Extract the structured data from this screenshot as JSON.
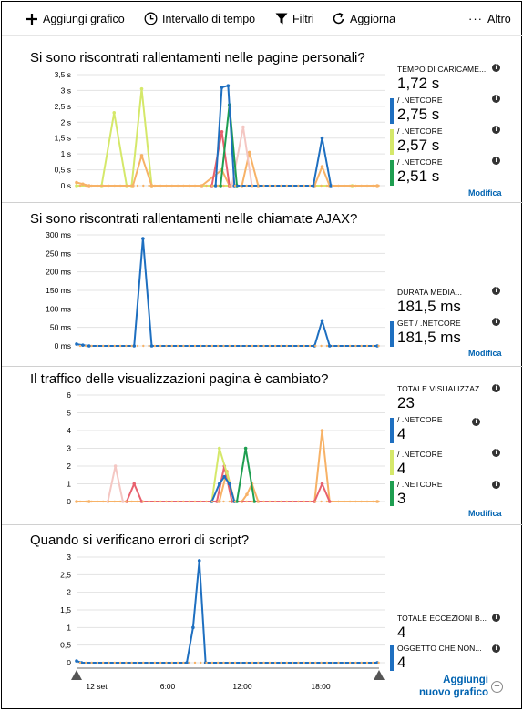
{
  "toolbar": {
    "add_chart": "Aggiungi grafico",
    "time_range": "Intervallo di tempo",
    "filters": "Filtri",
    "refresh": "Aggiorna",
    "more": "Altro"
  },
  "colors": {
    "blue": "#1e6fc0",
    "lime": "#d5e86a",
    "green": "#1e9e50",
    "orange": "#f7b267",
    "pink": "#f4c7c3",
    "red": "#e8616e",
    "link": "#0063b1"
  },
  "x_axis": {
    "labels": [
      "12 set",
      "6:00",
      "12:00",
      "18:00"
    ]
  },
  "sections": [
    {
      "title": "Si sono riscontrati rallentamenti nelle pagine personali?",
      "metrics": [
        {
          "label": "TEMPO DI CARICAME...",
          "value": "1,72 s",
          "bar": ""
        },
        {
          "label": "/ .NETCORE",
          "value": "2,75 s",
          "bar": "#1e6fc0"
        },
        {
          "label": "/ .NETCORE",
          "value": "2,57 s",
          "bar": "#d5e86a"
        },
        {
          "label": "/ .NETCORE",
          "value": "2,51 s",
          "bar": "#1e9e50"
        }
      ],
      "modifica": "Modifica"
    },
    {
      "title": "Si sono riscontrati rallentamenti nelle chiamate AJAX?",
      "metrics": [
        {
          "label": "DURATA MEDIA...",
          "value": "181,5 ms",
          "bar": ""
        },
        {
          "label": "GET / .NETCORE",
          "value": "181,5 ms",
          "bar": "#1e6fc0"
        }
      ],
      "modifica": "Modifica"
    },
    {
      "title": "Il traffico delle visualizzazioni pagina è cambiato?",
      "metrics": [
        {
          "label": "TOTALE VISUALIZZAZ...",
          "value": "23",
          "bar": ""
        },
        {
          "label": "/ .NETCORE",
          "value": "4",
          "bar": "#1e6fc0"
        },
        {
          "label": "/ .NETCORE",
          "value": "4",
          "bar": "#d5e86a"
        },
        {
          "label": "/ .NETCORE",
          "value": "3",
          "bar": "#1e9e50"
        }
      ],
      "modifica": "Modifica"
    },
    {
      "title": "Quando si verificano errori di script?",
      "metrics": [
        {
          "label": "TOTALE ECCEZIONI B...",
          "value": "4",
          "bar": ""
        },
        {
          "label": "OGGETTO CHE NON...",
          "value": "4",
          "bar": "#1e6fc0"
        }
      ]
    }
  ],
  "add_new_chart": {
    "line1": "Aggiungi",
    "line2": "nuovo grafico"
  },
  "chart_data": [
    {
      "type": "line",
      "title": "Si sono riscontrati rallentamenti nelle pagine personali?",
      "yticks": [
        "0 s",
        "0,5 s",
        "1 s",
        "1,5 s",
        "2 s",
        "2,5 s",
        "3 s",
        "3,5 s"
      ],
      "ylim": [
        0,
        3.5
      ],
      "xlim": [
        0,
        24
      ],
      "series": [
        {
          "color": "#d5e86a",
          "points": [
            [
              0,
              0
            ],
            [
              2,
              0
            ],
            [
              3,
              2.3
            ],
            [
              4,
              0
            ],
            [
              4.4,
              0
            ],
            [
              5.2,
              3.05
            ],
            [
              6,
              0
            ],
            [
              22,
              0
            ]
          ]
        },
        {
          "color": "#f7b267",
          "points": [
            [
              0,
              0.1
            ],
            [
              0.5,
              0.05
            ],
            [
              1,
              0
            ],
            [
              4.5,
              0
            ],
            [
              5.2,
              0.95
            ],
            [
              6,
              0
            ],
            [
              10,
              0
            ],
            [
              11.6,
              0.5
            ],
            [
              12.2,
              0
            ],
            [
              13.2,
              0
            ],
            [
              13.8,
              1.05
            ],
            [
              14.5,
              0
            ],
            [
              19,
              0
            ],
            [
              19.6,
              0.6
            ],
            [
              20.2,
              0
            ],
            [
              24,
              0
            ]
          ]
        },
        {
          "color": "#f4c7c3",
          "points": [
            [
              12.4,
              0
            ],
            [
              13.3,
              1.85
            ],
            [
              14,
              0
            ]
          ]
        },
        {
          "color": "#e8616e",
          "points": [
            [
              10.8,
              0
            ],
            [
              11.6,
              1.7
            ],
            [
              12.2,
              0
            ]
          ]
        },
        {
          "color": "#1e9e50",
          "points": [
            [
              11.5,
              0
            ],
            [
              12.2,
              2.55
            ],
            [
              12.8,
              0
            ]
          ]
        },
        {
          "color": "#1e6fc0",
          "points": [
            [
              11.1,
              0
            ],
            [
              11.6,
              3.1
            ],
            [
              12.1,
              3.15
            ],
            [
              12.6,
              0
            ],
            [
              18.9,
              0
            ],
            [
              19.6,
              1.5
            ],
            [
              20.3,
              0
            ]
          ]
        }
      ]
    },
    {
      "type": "line",
      "title": "Si sono riscontrati rallentamenti nelle chiamate AJAX?",
      "yticks": [
        "0 ms",
        "50 ms",
        "100 ms",
        "150 ms",
        "200 ms",
        "250 ms",
        "300 ms"
      ],
      "ylim": [
        0,
        300
      ],
      "xlim": [
        0,
        24
      ],
      "series": [
        {
          "color": "#1e6fc0",
          "points": [
            [
              0,
              5
            ],
            [
              0.5,
              2
            ],
            [
              1,
              0
            ],
            [
              4.6,
              0
            ],
            [
              5.3,
              290
            ],
            [
              6,
              0
            ],
            [
              19,
              0
            ],
            [
              19.6,
              68
            ],
            [
              20.2,
              0
            ],
            [
              24,
              0
            ]
          ]
        }
      ]
    },
    {
      "type": "line",
      "title": "Il traffico delle visualizzazioni pagina è cambiato?",
      "yticks": [
        "0",
        "1",
        "2",
        "3",
        "4",
        "5",
        "6"
      ],
      "ylim": [
        0,
        6
      ],
      "xlim": [
        0,
        24
      ],
      "series": [
        {
          "color": "#f7b267",
          "points": [
            [
              0,
              0
            ],
            [
              1,
              0
            ],
            [
              11.4,
              0
            ],
            [
              12,
              1.7
            ],
            [
              12.6,
              0
            ],
            [
              13.2,
              0
            ],
            [
              13.6,
              0.4
            ],
            [
              14,
              1
            ],
            [
              14.5,
              0
            ],
            [
              19,
              0
            ],
            [
              19.6,
              4
            ],
            [
              20.2,
              0
            ],
            [
              24,
              0
            ]
          ]
        },
        {
          "color": "#f4c7c3",
          "points": [
            [
              2.5,
              0
            ],
            [
              3.1,
              2
            ],
            [
              3.7,
              0
            ]
          ]
        },
        {
          "color": "#e8616e",
          "points": [
            [
              4,
              0
            ],
            [
              4.6,
              1
            ],
            [
              5.2,
              0
            ],
            [
              11.2,
              0
            ],
            [
              11.8,
              2
            ],
            [
              12.4,
              0
            ],
            [
              19,
              0
            ],
            [
              19.6,
              1
            ],
            [
              20.2,
              0
            ]
          ]
        },
        {
          "color": "#d5e86a",
          "points": [
            [
              10.8,
              0
            ],
            [
              11.4,
              3
            ],
            [
              12,
              1.6
            ],
            [
              12.6,
              0
            ]
          ]
        },
        {
          "color": "#1e6fc0",
          "points": [
            [
              10.8,
              0
            ],
            [
              11.4,
              1
            ],
            [
              11.8,
              1.4
            ],
            [
              12.2,
              1
            ],
            [
              12.6,
              0
            ]
          ]
        },
        {
          "color": "#1e9e50",
          "points": [
            [
              12.8,
              0
            ],
            [
              13.5,
              3
            ],
            [
              14.2,
              0
            ]
          ]
        }
      ]
    },
    {
      "type": "line",
      "title": "Quando si verificano errori di script?",
      "yticks": [
        "0",
        "0,5",
        "1",
        "1,5",
        "2",
        "2,5",
        "3"
      ],
      "ylim": [
        0,
        3
      ],
      "xlim": [
        0,
        24
      ],
      "series": [
        {
          "color": "#1e6fc0",
          "points": [
            [
              0,
              0.05
            ],
            [
              0.4,
              0
            ],
            [
              8.8,
              0
            ],
            [
              9.3,
              1
            ],
            [
              9.8,
              2.9
            ],
            [
              10.3,
              0
            ],
            [
              24,
              0
            ]
          ]
        }
      ]
    }
  ]
}
